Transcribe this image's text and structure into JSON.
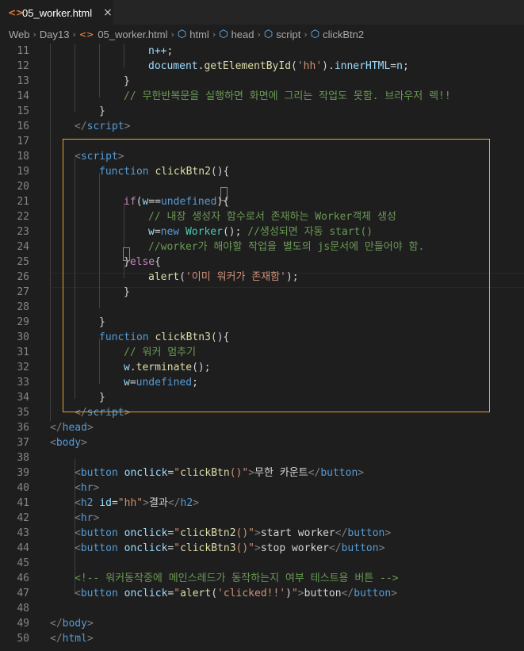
{
  "tab": {
    "icon": "html-file-icon",
    "title": "05_worker.html",
    "close": "×"
  },
  "breadcrumb": {
    "items": [
      {
        "label": "Web",
        "icon": ""
      },
      {
        "label": "Day13",
        "icon": ""
      },
      {
        "label": "05_worker.html",
        "icon": "html-file-icon"
      },
      {
        "label": "html",
        "icon": "symbol-box-icon"
      },
      {
        "label": "head",
        "icon": "symbol-box-icon"
      },
      {
        "label": "script",
        "icon": "symbol-box-icon"
      },
      {
        "label": "clickBtn2",
        "icon": "symbol-box-icon"
      }
    ],
    "separator": "›"
  },
  "lines": [
    {
      "n": "11",
      "indent": 4,
      "tokens": [
        [
          "v",
          "n++"
        ],
        [
          "p",
          ";"
        ]
      ]
    },
    {
      "n": "12",
      "indent": 4,
      "tokens": [
        [
          "v",
          "document"
        ],
        [
          "p",
          "."
        ],
        [
          "f",
          "getElementById"
        ],
        [
          "p",
          "("
        ],
        [
          "s",
          "'hh'"
        ],
        [
          "p",
          ")."
        ],
        [
          "v",
          "innerHTML"
        ],
        [
          "p",
          "="
        ],
        [
          "v",
          "n"
        ],
        [
          "p",
          ";"
        ]
      ]
    },
    {
      "n": "13",
      "indent": 3,
      "tokens": [
        [
          "p",
          "}"
        ]
      ]
    },
    {
      "n": "14",
      "indent": 3,
      "tokens": [
        [
          "c",
          "// 무한반복문을 실행하면 화면에 그리는 작업도 못함. 브라우저 렉!!"
        ]
      ]
    },
    {
      "n": "15",
      "indent": 2,
      "tokens": [
        [
          "p",
          "}"
        ]
      ]
    },
    {
      "n": "16",
      "indent": 1,
      "tokens": [
        [
          "b",
          "</"
        ],
        [
          "t",
          "script"
        ],
        [
          "b",
          ">"
        ]
      ]
    },
    {
      "n": "17",
      "indent": 0,
      "tokens": []
    },
    {
      "n": "18",
      "indent": 1,
      "tokens": [
        [
          "b",
          "<"
        ],
        [
          "t",
          "script"
        ],
        [
          "b",
          ">"
        ]
      ]
    },
    {
      "n": "19",
      "indent": 2,
      "tokens": [
        [
          "k",
          "function"
        ],
        [
          "p",
          " "
        ],
        [
          "f",
          "clickBtn2"
        ],
        [
          "p",
          "(){"
        ]
      ]
    },
    {
      "n": "20",
      "indent": 0,
      "tokens": []
    },
    {
      "n": "21",
      "indent": 3,
      "tokens": [
        [
          "q",
          "if"
        ],
        [
          "p",
          "("
        ],
        [
          "v",
          "w"
        ],
        [
          "p",
          "=="
        ],
        [
          "k",
          "undefined"
        ],
        [
          "p",
          ")"
        ],
        [
          "p",
          "{"
        ]
      ]
    },
    {
      "n": "22",
      "indent": 4,
      "tokens": [
        [
          "c",
          "// 내장 생성자 함수로서 존재하는 Worker객체 생성"
        ]
      ]
    },
    {
      "n": "23",
      "indent": 4,
      "tokens": [
        [
          "v",
          "w"
        ],
        [
          "p",
          "="
        ],
        [
          "k",
          "new"
        ],
        [
          "p",
          " "
        ],
        [
          "y",
          "Worker"
        ],
        [
          "p",
          "(); "
        ],
        [
          "c",
          "//생성되면 자동 start()"
        ]
      ]
    },
    {
      "n": "24",
      "indent": 4,
      "tokens": [
        [
          "c",
          "//worker가 해야할 작업을 별도의 js문서에 만들어야 함."
        ]
      ]
    },
    {
      "n": "25",
      "indent": 3,
      "tokens": [
        [
          "p",
          "}"
        ],
        [
          "q",
          "else"
        ],
        [
          "p",
          "{"
        ]
      ]
    },
    {
      "n": "26",
      "indent": 4,
      "tokens": [
        [
          "f",
          "alert"
        ],
        [
          "p",
          "("
        ],
        [
          "s",
          "'이미 워커가 존재함'"
        ],
        [
          "p",
          ");"
        ]
      ]
    },
    {
      "n": "27",
      "indent": 3,
      "tokens": [
        [
          "p",
          "}"
        ]
      ]
    },
    {
      "n": "28",
      "indent": 0,
      "tokens": []
    },
    {
      "n": "29",
      "indent": 2,
      "tokens": [
        [
          "p",
          "}"
        ]
      ]
    },
    {
      "n": "30",
      "indent": 2,
      "tokens": [
        [
          "k",
          "function"
        ],
        [
          "p",
          " "
        ],
        [
          "f",
          "clickBtn3"
        ],
        [
          "p",
          "(){"
        ]
      ]
    },
    {
      "n": "31",
      "indent": 3,
      "tokens": [
        [
          "c",
          "// 워커 멈추기"
        ]
      ]
    },
    {
      "n": "32",
      "indent": 3,
      "tokens": [
        [
          "v",
          "w"
        ],
        [
          "p",
          "."
        ],
        [
          "f",
          "terminate"
        ],
        [
          "p",
          "();"
        ]
      ]
    },
    {
      "n": "33",
      "indent": 3,
      "tokens": [
        [
          "v",
          "w"
        ],
        [
          "p",
          "="
        ],
        [
          "k",
          "undefined"
        ],
        [
          "p",
          ";"
        ]
      ]
    },
    {
      "n": "34",
      "indent": 2,
      "tokens": [
        [
          "p",
          "}"
        ]
      ]
    },
    {
      "n": "35",
      "indent": 1,
      "tokens": [
        [
          "b",
          "</"
        ],
        [
          "t",
          "script"
        ],
        [
          "b",
          ">"
        ]
      ]
    },
    {
      "n": "36",
      "indent": 0,
      "tokens": [
        [
          "b",
          "</"
        ],
        [
          "t",
          "head"
        ],
        [
          "b",
          ">"
        ]
      ]
    },
    {
      "n": "37",
      "indent": 0,
      "tokens": [
        [
          "b",
          "<"
        ],
        [
          "t",
          "body"
        ],
        [
          "b",
          ">"
        ]
      ]
    },
    {
      "n": "38",
      "indent": 0,
      "tokens": []
    },
    {
      "n": "39",
      "indent": 1,
      "tokens": [
        [
          "b",
          "<"
        ],
        [
          "t",
          "button"
        ],
        [
          "p",
          " "
        ],
        [
          "a",
          "onclick"
        ],
        [
          "p",
          "="
        ],
        [
          "s",
          "\""
        ],
        [
          "f",
          "clickBtn"
        ],
        [
          "s",
          "()\""
        ],
        [
          "b",
          ">"
        ],
        [
          "x",
          "무한 카운트"
        ],
        [
          "b",
          "</"
        ],
        [
          "t",
          "button"
        ],
        [
          "b",
          ">"
        ]
      ]
    },
    {
      "n": "40",
      "indent": 1,
      "tokens": [
        [
          "b",
          "<"
        ],
        [
          "t",
          "hr"
        ],
        [
          "b",
          ">"
        ]
      ]
    },
    {
      "n": "41",
      "indent": 1,
      "tokens": [
        [
          "b",
          "<"
        ],
        [
          "t",
          "h2"
        ],
        [
          "p",
          " "
        ],
        [
          "a",
          "id"
        ],
        [
          "p",
          "="
        ],
        [
          "s",
          "\"hh\""
        ],
        [
          "b",
          ">"
        ],
        [
          "x",
          "결과"
        ],
        [
          "b",
          "</"
        ],
        [
          "t",
          "h2"
        ],
        [
          "b",
          ">"
        ]
      ]
    },
    {
      "n": "42",
      "indent": 1,
      "tokens": [
        [
          "b",
          "<"
        ],
        [
          "t",
          "hr"
        ],
        [
          "b",
          ">"
        ]
      ]
    },
    {
      "n": "43",
      "indent": 1,
      "tokens": [
        [
          "b",
          "<"
        ],
        [
          "t",
          "button"
        ],
        [
          "p",
          " "
        ],
        [
          "a",
          "onclick"
        ],
        [
          "p",
          "="
        ],
        [
          "s",
          "\""
        ],
        [
          "f",
          "clickBtn2"
        ],
        [
          "s",
          "()\""
        ],
        [
          "b",
          ">"
        ],
        [
          "x",
          "start worker"
        ],
        [
          "b",
          "</"
        ],
        [
          "t",
          "button"
        ],
        [
          "b",
          ">"
        ]
      ]
    },
    {
      "n": "44",
      "indent": 1,
      "tokens": [
        [
          "b",
          "<"
        ],
        [
          "t",
          "button"
        ],
        [
          "p",
          " "
        ],
        [
          "a",
          "onclick"
        ],
        [
          "p",
          "="
        ],
        [
          "s",
          "\""
        ],
        [
          "f",
          "clickBtn3"
        ],
        [
          "s",
          "()\""
        ],
        [
          "b",
          ">"
        ],
        [
          "x",
          "stop worker"
        ],
        [
          "b",
          "</"
        ],
        [
          "t",
          "button"
        ],
        [
          "b",
          ">"
        ]
      ]
    },
    {
      "n": "45",
      "indent": 0,
      "tokens": []
    },
    {
      "n": "46",
      "indent": 1,
      "tokens": [
        [
          "c",
          "<!-- 워커동작중에 메인스레드가 동작하는지 여부 테스트용 버튼 -->"
        ]
      ]
    },
    {
      "n": "47",
      "indent": 1,
      "tokens": [
        [
          "b",
          "<"
        ],
        [
          "t",
          "button"
        ],
        [
          "p",
          " "
        ],
        [
          "a",
          "onclick"
        ],
        [
          "p",
          "="
        ],
        [
          "s",
          "\""
        ],
        [
          "f",
          "alert"
        ],
        [
          "p",
          "("
        ],
        [
          "s",
          "'clicked!!'"
        ],
        [
          "p",
          ")"
        ],
        [
          "s",
          "\""
        ],
        [
          "b",
          ">"
        ],
        [
          "x",
          "button"
        ],
        [
          "b",
          "</"
        ],
        [
          "t",
          "button"
        ],
        [
          "b",
          ">"
        ]
      ]
    },
    {
      "n": "48",
      "indent": 0,
      "tokens": []
    },
    {
      "n": "49",
      "indent": 0,
      "tokens": [
        [
          "b",
          "</"
        ],
        [
          "t",
          "body"
        ],
        [
          "b",
          ">"
        ]
      ]
    },
    {
      "n": "50",
      "indent": 0,
      "tokens": [
        [
          "b",
          "</"
        ],
        [
          "t",
          "html"
        ],
        [
          "b",
          ">"
        ]
      ]
    }
  ]
}
